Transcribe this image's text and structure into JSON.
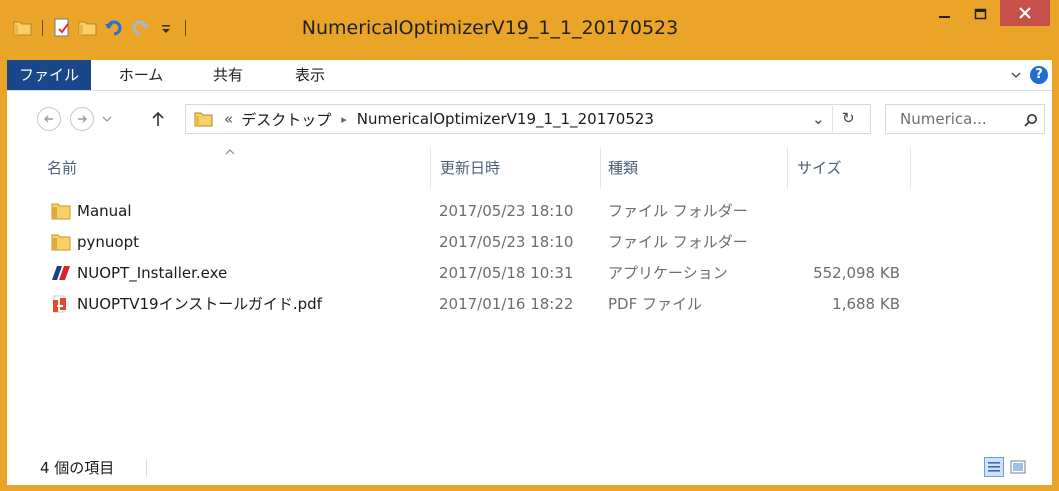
{
  "window": {
    "title": "NumericalOptimizerV19_1_1_20170523",
    "close_glyph": "✕",
    "min_glyph": "–"
  },
  "ribbon": {
    "tabs": [
      "ファイル",
      "ホーム",
      "共有",
      "表示"
    ]
  },
  "address": {
    "chevron": "«",
    "breadcrumb": [
      "デスクトップ",
      "NumericalOptimizerV19_1_1_20170523"
    ],
    "separator": "▸",
    "dropdown_glyph": "⌄",
    "refresh_glyph": "↻"
  },
  "search": {
    "placeholder": "Numerica...",
    "icon": "search-icon"
  },
  "columns": [
    "名前",
    "更新日時",
    "種類",
    "サイズ"
  ],
  "files": [
    {
      "name": "Manual",
      "date": "2017/05/23 18:10",
      "type": "ファイル フォルダー",
      "size": "",
      "icon": "folder-icon"
    },
    {
      "name": "pynuopt",
      "date": "2017/05/23 18:10",
      "type": "ファイル フォルダー",
      "size": "",
      "icon": "folder-icon"
    },
    {
      "name": "NUOPT_Installer.exe",
      "date": "2017/05/18 10:31",
      "type": "アプリケーション",
      "size": "552,098 KB",
      "icon": "nuopt-app-icon"
    },
    {
      "name": "NUOPTV19インストールガイド.pdf",
      "date": "2017/01/16 18:22",
      "type": "PDF ファイル",
      "size": "1,688 KB",
      "icon": "pdf-icon"
    }
  ],
  "status": {
    "count": "4 個の項目"
  },
  "colors": {
    "frame": "#eaa428",
    "file_tab": "#19478a",
    "close_button": "#c7504a",
    "header_text": "#4c607a"
  }
}
